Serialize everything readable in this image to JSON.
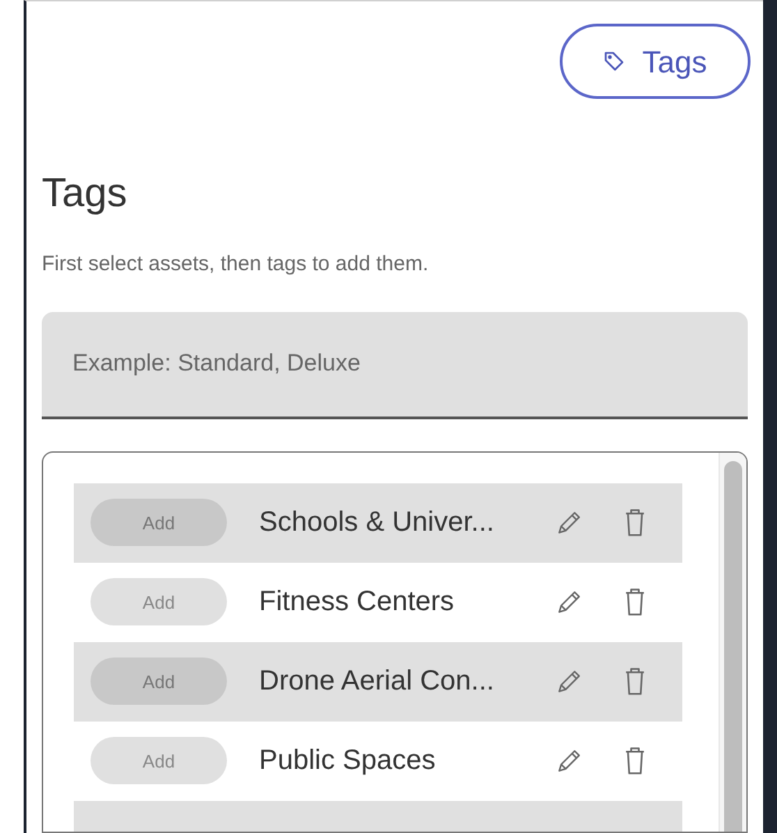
{
  "header_button": {
    "label": "Tags"
  },
  "title": "Tags",
  "hint": "First select assets, then tags to add them.",
  "tag_input": {
    "placeholder": "Example: Standard, Deluxe"
  },
  "tags": [
    {
      "add_label": "Add",
      "name": "Schools & Univer..."
    },
    {
      "add_label": "Add",
      "name": "Fitness Centers"
    },
    {
      "add_label": "Add",
      "name": "Drone Aerial Con..."
    },
    {
      "add_label": "Add",
      "name": "Public Spaces"
    }
  ]
}
